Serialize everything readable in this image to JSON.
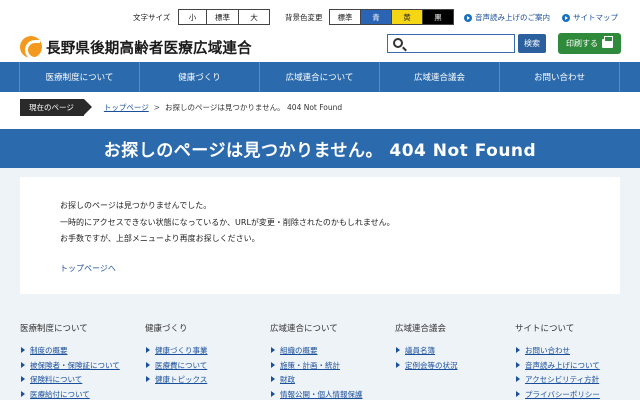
{
  "utility": {
    "font_size_label": "文字サイズ",
    "font_sizes": [
      "小",
      "標準",
      "大"
    ],
    "bg_color_label": "背景色変更",
    "bg_colors": [
      "標準",
      "青",
      "黄",
      "黒"
    ],
    "speech_link": "音声読み上げのご案内",
    "sitemap_link": "サイトマップ"
  },
  "header": {
    "org_name": "長野県後期高齢者医療広域連合",
    "search_placeholder": "",
    "search_button": "検索",
    "print_button": "印刷する"
  },
  "nav": {
    "items": [
      "医療制度について",
      "健康づくり",
      "広域連合について",
      "広域連合議会",
      "お問い合わせ"
    ]
  },
  "breadcrumb": {
    "here_label": "現在のページ",
    "top_link": "トップページ",
    "separator": ">",
    "current": "お探しのページは見つかりません。 404 Not Found"
  },
  "page": {
    "title": "お探しのページは見つかりません。 404 Not Found",
    "lines": [
      "お探しのページは見つかりませんでした。",
      "一時的にアクセスできない状態になっているか、URLが変更・削除されたのかもしれません。",
      "お手数ですが、上部メニューより再度お探しください。"
    ],
    "top_link": "トップページへ"
  },
  "footer": {
    "columns": [
      {
        "heading": "医療制度について",
        "links": [
          "制度の概要",
          "被保険者・保険証について",
          "保険料について",
          "医療給付について"
        ]
      },
      {
        "heading": "健康づくり",
        "links": [
          "健康づくり事業",
          "医療費について",
          "健康トピックス"
        ]
      },
      {
        "heading": "広域連合について",
        "links": [
          "組織の概要",
          "施策・計画・統計",
          "財政",
          "情報公開・個人情報保護"
        ]
      },
      {
        "heading": "広域連合議会",
        "links": [
          "議員名簿",
          "定例会等の状況"
        ]
      },
      {
        "heading": "サイトについて",
        "links": [
          "お問い合わせ",
          "音声読み上げについて",
          "アクセシビリティ方針",
          "プライバシーポリシー"
        ]
      }
    ]
  },
  "colors": {
    "primary_blue": "#2b6aad",
    "print_green": "#2f8a3c",
    "logo_orange": "#f39a1e",
    "bg_blue": "#2b63b5",
    "bg_yellow": "#f5d615",
    "bg_black": "#000000"
  }
}
